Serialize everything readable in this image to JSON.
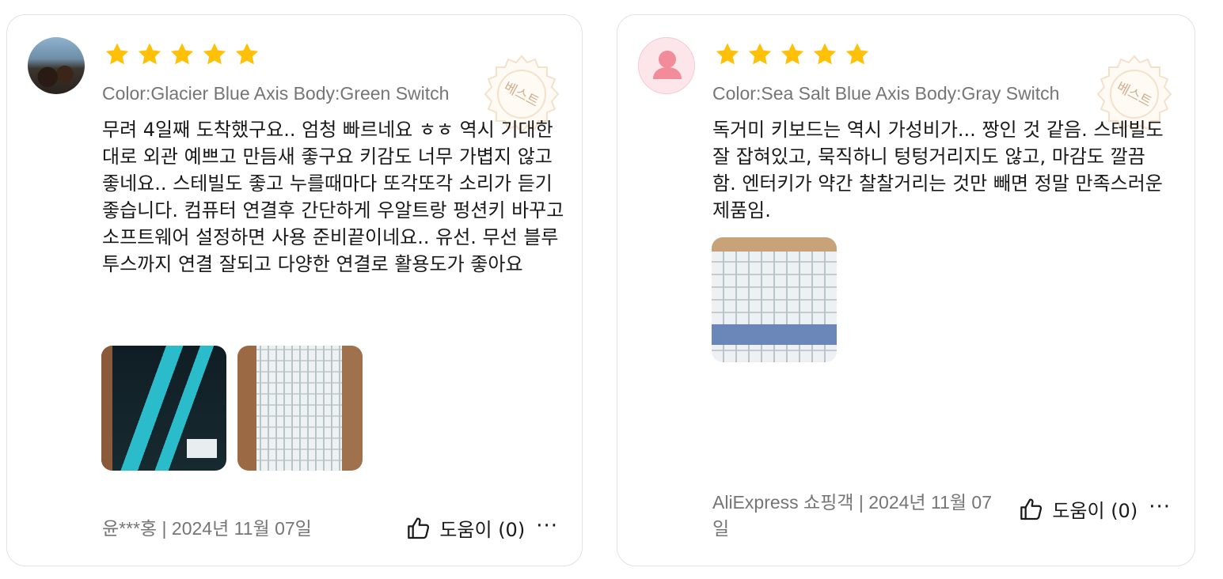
{
  "colors": {
    "star": "#ffc107",
    "muted_text": "#757575",
    "text": "#191919",
    "border": "#e2e2e2"
  },
  "reviews": [
    {
      "avatar": "user-photo",
      "rating": 5,
      "sku": "Color:Glacier Blue Axis Body:Green Switch",
      "stamp": "베스트",
      "text": "무려 4일째 도착했구요.. 엄청 빠르네요 ㅎㅎ 역시 기대한대로 외관 예쁘고 만듬새 좋구요 키감도 너무 가볍지 않고 좋네요.. 스테빌도 좋고 누를때마다 또각또각 소리가 듣기 좋습니다. 컴퓨터 연결후 간단하게 우알트랑 펑션키 바꾸고 소프트웨어 설정하면 사용 준비끝이네요.. 유선. 무선 블루투스까지 연결 잘되고 다양한 연결로 활용도가 좋아요",
      "photos": [
        "box-photo",
        "keyboard-photo"
      ],
      "byline": "윤***홍 | 2024년 11월 07일",
      "helpful_label": "도움이 (0)",
      "more": "···"
    },
    {
      "avatar": "default-avatar",
      "rating": 5,
      "sku": "Color:Sea Salt Blue Axis Body:Gray Switch",
      "stamp": "베스트",
      "text": "독거미 키보드는 역시 가성비가... 짱인 것 같음. 스테빌도 잘 잡혀있고, 묵직하니 텅텅거리지도 않고, 마감도 깔끔함. 엔터키가 약간 찰찰거리는 것만 빼면 정말 만족스러운 제품임.",
      "photos": [
        "keyboard-photo"
      ],
      "byline": "AliExpress 쇼핑객 | 2024년 11월 07일",
      "helpful_label": "도움이 (0)",
      "more": "···"
    }
  ]
}
